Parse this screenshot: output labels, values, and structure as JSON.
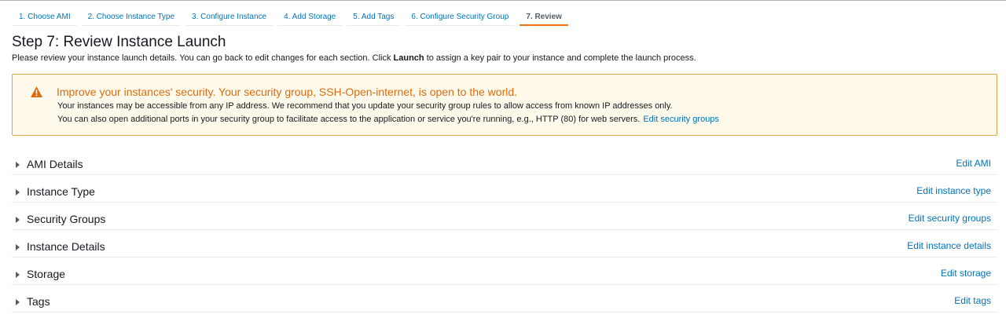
{
  "wizard": {
    "steps": [
      "1. Choose AMI",
      "2. Choose Instance Type",
      "3. Configure Instance",
      "4. Add Storage",
      "5. Add Tags",
      "6. Configure Security Group",
      "7. Review"
    ],
    "active_step": "7. Review"
  },
  "page": {
    "title": "Step 7: Review Instance Launch",
    "intro_before": "Please review your instance launch details. You can go back to edit changes for each section. Click ",
    "intro_bold": "Launch",
    "intro_after": " to assign a key pair to your instance and complete the launch process."
  },
  "alert": {
    "icon": "warning-icon",
    "title": "Improve your instances' security. Your security group, SSH-Open-internet, is open to the world.",
    "line1": "Your instances may be accessible from any IP address. We recommend that you update your security group rules to allow access from known IP addresses only.",
    "line2": "You can also open additional ports in your security group to facilitate access to the application or service you're running, e.g., HTTP (80) for web servers.",
    "link": "Edit security groups"
  },
  "sections": [
    {
      "title": "AMI Details",
      "edit": "Edit AMI"
    },
    {
      "title": "Instance Type",
      "edit": "Edit instance type"
    },
    {
      "title": "Security Groups",
      "edit": "Edit security groups"
    },
    {
      "title": "Instance Details",
      "edit": "Edit instance details"
    },
    {
      "title": "Storage",
      "edit": "Edit storage"
    },
    {
      "title": "Tags",
      "edit": "Edit tags"
    }
  ],
  "colors": {
    "link": "#0073bb",
    "accent": "#ec7211",
    "warning_text": "#dd6b10",
    "warning_bg": "#fffaeb",
    "warning_border": "#e0a44b"
  }
}
